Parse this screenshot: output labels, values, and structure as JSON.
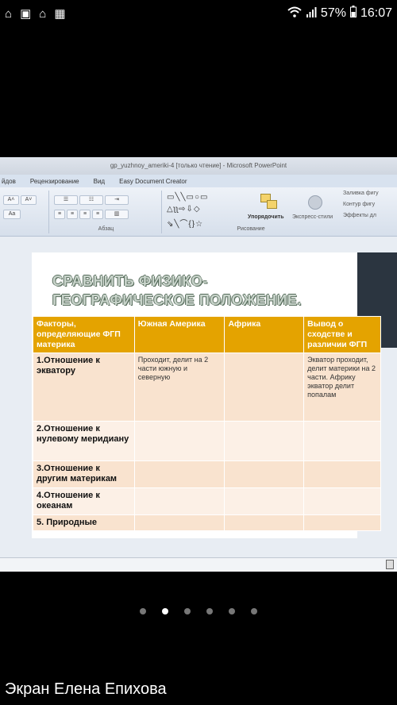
{
  "status_bar": {
    "left_icons": [
      "gamepad-icon",
      "image-icon",
      "gamepad-icon",
      "gallery-icon"
    ],
    "wifi": "wifi-icon",
    "signal": "signal-icon",
    "battery": "57%",
    "time": "16:07"
  },
  "window": {
    "title": "gp_yuzhnoy_ameriki-4 [только чтение] - Microsoft PowerPoint"
  },
  "ribbon": {
    "tabs": [
      "йдов",
      "Рецензирование",
      "Вид",
      "Easy Document Creator"
    ],
    "groups": {
      "paragraph_label": "Абзац",
      "drawing_label": "Рисование",
      "arrange_label": "Упорядочить",
      "quick_styles_label": "Экспресс-стили",
      "shape_fill": "Заливка фигу",
      "shape_outline": "Контур фигу",
      "shape_effects": "Эффекты дл"
    },
    "font_buttons": [
      "A˄",
      "A˅",
      "Aa"
    ]
  },
  "slide": {
    "title_line1": "СРАВНИТЬ ФИЗИКО-",
    "title_line2": "ГЕОГРАФИЧЕСКОЕ ПОЛОЖЕНИЕ.",
    "table": {
      "headers": [
        "Факторы, определяющие ФГП материка",
        "Южная Америка",
        "Африка",
        "Вывод о сходстве и различии  ФГП"
      ],
      "rows": [
        {
          "factor": "1.Отношение к экватору",
          "south_america": "Проходит, делит на 2 части южную и северную",
          "africa": "",
          "conclusion": "Экватор проходит, делит материки на 2 части. Африку экватор делит попалам"
        },
        {
          "factor": "2.Отношение к нулевому меридиану",
          "south_america": "",
          "africa": "",
          "conclusion": ""
        },
        {
          "factor": "3.Отношение к другим материкам",
          "south_america": "",
          "africa": "",
          "conclusion": ""
        },
        {
          "factor": "4.Отношение к океанам",
          "south_america": "",
          "africa": "",
          "conclusion": ""
        },
        {
          "factor": "5. Природные",
          "south_america": "",
          "africa": "",
          "conclusion": ""
        }
      ]
    }
  },
  "gallery": {
    "dot_count": 6,
    "active_dot": 1
  },
  "caption": "Экран Елена Епихова"
}
